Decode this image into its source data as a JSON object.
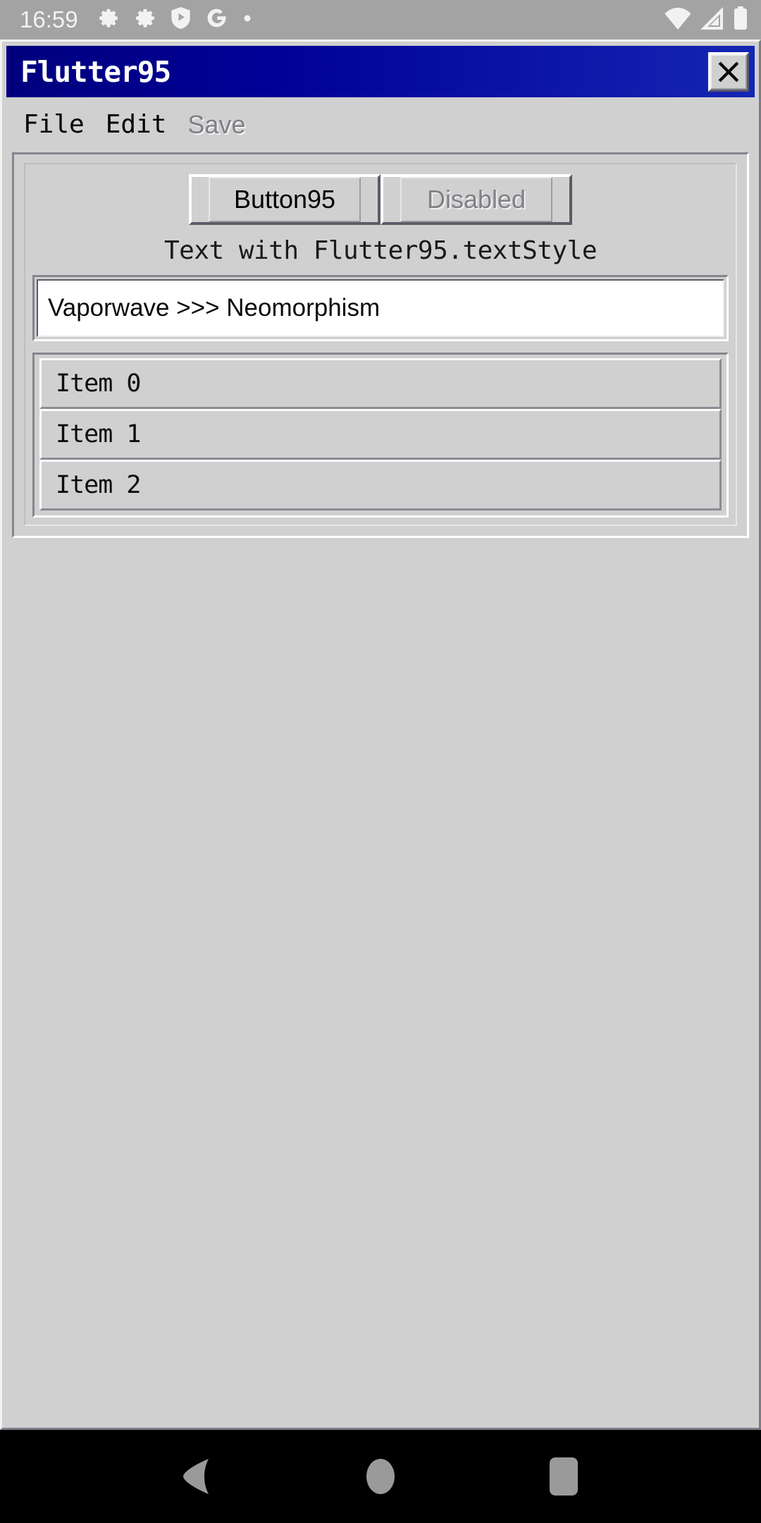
{
  "status_bar": {
    "time": "16:59",
    "left_icons": [
      "gear-icon",
      "gear-icon",
      "shield-play-icon",
      "google-g-icon",
      "dot-icon"
    ],
    "right_icons": [
      "wifi-icon",
      "cell-signal-icon",
      "battery-icon"
    ],
    "background_color": "#a3a3a3",
    "foreground_color": "#f2f2f2"
  },
  "window": {
    "title": "Flutter95",
    "close_label": "✕",
    "titlebar_gradient_from": "#00007e",
    "titlebar_gradient_to": "#1525b4",
    "face_color": "#d0d0d0"
  },
  "menu_bar": {
    "items": [
      {
        "label": "File",
        "disabled": false
      },
      {
        "label": "Edit",
        "disabled": false
      },
      {
        "label": "Save",
        "disabled": true
      }
    ]
  },
  "content": {
    "buttons": [
      {
        "label": "Button95",
        "disabled": false
      },
      {
        "label": "Disabled",
        "disabled": true
      }
    ],
    "style_label": "Text with Flutter95.textStyle",
    "text_field": {
      "value": "Vaporwave >>> Neomorphism",
      "placeholder": ""
    },
    "list_items": [
      {
        "label": "Item 0"
      },
      {
        "label": "Item 1"
      },
      {
        "label": "Item 2"
      }
    ]
  },
  "nav_bar": {
    "buttons": [
      "back-icon",
      "home-icon",
      "recents-icon"
    ],
    "background_color": "#000000",
    "icon_color": "#9a9a9a"
  }
}
